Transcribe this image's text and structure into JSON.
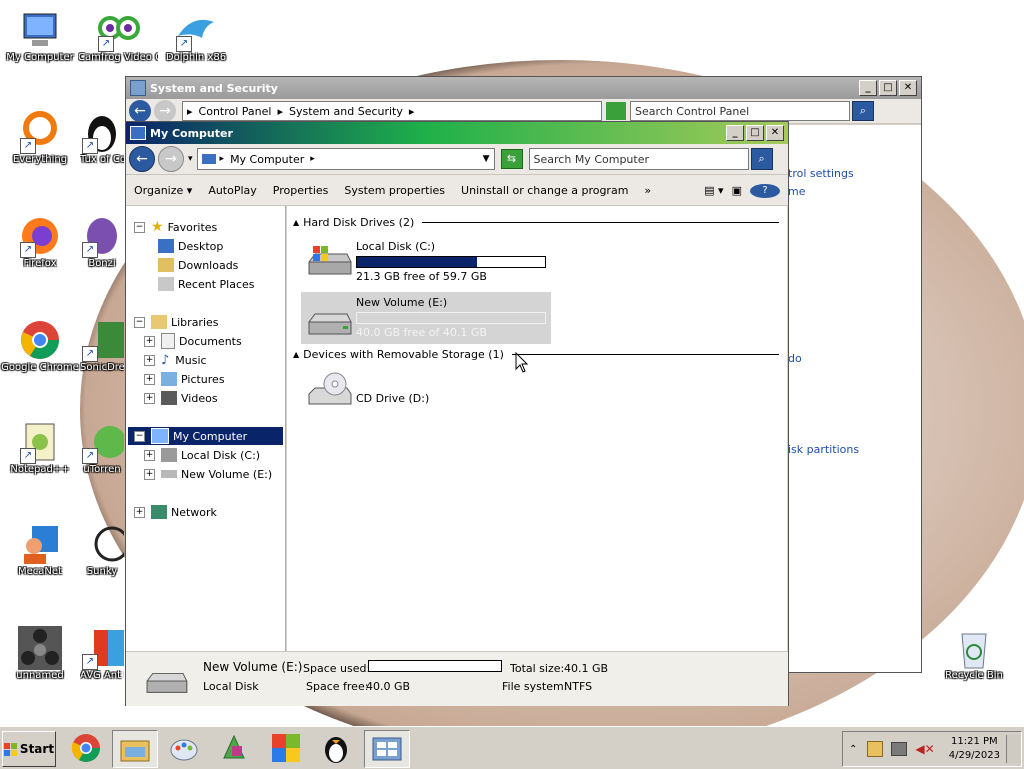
{
  "desktop": {
    "icons": [
      {
        "label": "My Computer",
        "name": "my-computer"
      },
      {
        "label": "Camfrog Video Chat",
        "name": "camfrog"
      },
      {
        "label": "Dolphin x86",
        "name": "dolphin"
      },
      {
        "label": "Everything",
        "name": "everything"
      },
      {
        "label": "Tux of Comm",
        "name": "tux"
      },
      {
        "label": "Firefox",
        "name": "firefox"
      },
      {
        "label": "Bonzi",
        "name": "bonzi"
      },
      {
        "label": "Google Chrome",
        "name": "chrome"
      },
      {
        "label": "SonicDre - Shor",
        "name": "sonic"
      },
      {
        "label": "Notepad++",
        "name": "notepadpp"
      },
      {
        "label": "uTorren",
        "name": "utorrent"
      },
      {
        "label": "MecaNet",
        "name": "mecanet"
      },
      {
        "label": "Sunky",
        "name": "sunky"
      },
      {
        "label": "unnamed",
        "name": "unnamed"
      },
      {
        "label": "AVG Ant Fre",
        "name": "avg"
      },
      {
        "label": "Recycle Bin",
        "name": "recycle-bin"
      }
    ]
  },
  "back_window": {
    "title": "System and Security",
    "address": [
      "Control Panel",
      "System and Security"
    ],
    "search_placeholder": "Search Control Panel",
    "partial_links": [
      "trol settings",
      "me",
      "do",
      "isk partitions"
    ]
  },
  "window": {
    "title": "My Computer",
    "address": "My Computer",
    "search_placeholder": "Search My Computer",
    "toolbar": {
      "organize": "Organize",
      "autoplay": "AutoPlay",
      "properties": "Properties",
      "system_properties": "System properties",
      "uninstall": "Uninstall or change a program",
      "more": "»"
    },
    "nav": {
      "favorites": "Favorites",
      "desktop": "Desktop",
      "downloads": "Downloads",
      "recent": "Recent Places",
      "libraries": "Libraries",
      "documents": "Documents",
      "music": "Music",
      "pictures": "Pictures",
      "videos": "Videos",
      "my_computer": "My Computer",
      "local_disk": "Local Disk (C:)",
      "new_volume": "New Volume (E:)",
      "network": "Network"
    },
    "groups": {
      "hdd": "Hard Disk Drives (2)",
      "removable": "Devices with Removable Storage (1)"
    },
    "drives": [
      {
        "name": "Local Disk (C:)",
        "free": "21.3 GB free of 59.7 GB",
        "used_fraction": 0.64
      },
      {
        "name": "New Volume (E:)",
        "free": "40.0 GB free of 40.1 GB",
        "used_fraction": 0.0
      }
    ],
    "cd": {
      "name": "CD Drive (D:)"
    },
    "details": {
      "name": "New Volume (E:)",
      "type": "Local Disk",
      "space_used_label": "Space used:",
      "space_free_label": "Space free:",
      "space_free": "40.0 GB",
      "total_size_label": "Total size:",
      "total_size": "40.1 GB",
      "fs_label": "File system:",
      "fs": "NTFS",
      "used_fraction": 0.0
    }
  },
  "taskbar": {
    "start": "Start",
    "time": "11:21 PM",
    "date": "4/29/2023"
  }
}
